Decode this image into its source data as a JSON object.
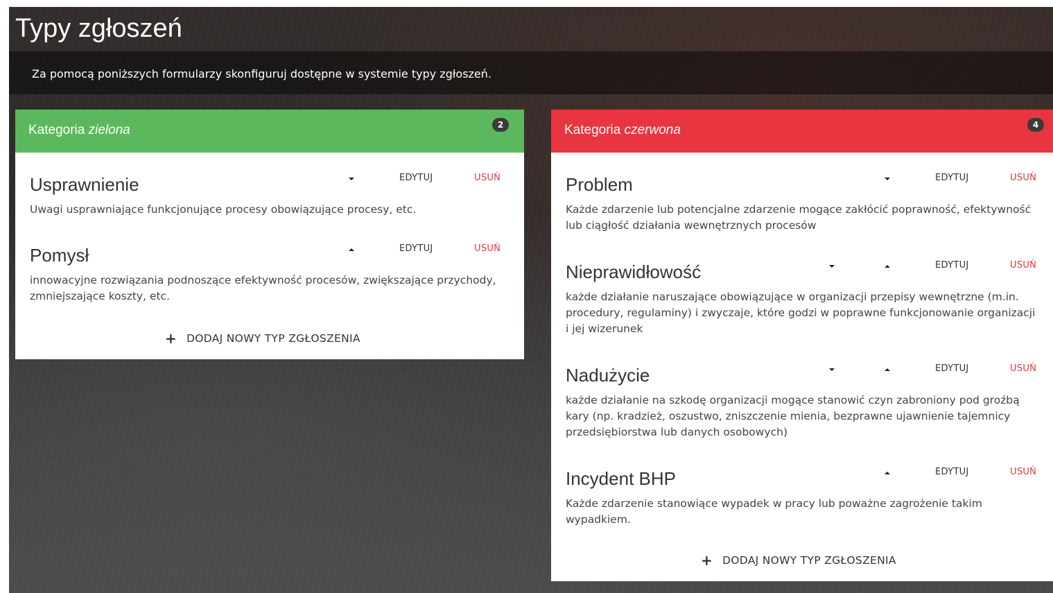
{
  "page": {
    "title": "Typy zgłoszeń",
    "description": "Za pomocą poniższych formularzy skonfiguruj dostępne w systemie typy zgłoszeń."
  },
  "colors": {
    "green": "#5cb85c",
    "red": "#e9353f",
    "badge": "#3a3a3a"
  },
  "categories": [
    {
      "label_prefix": "Kategoria",
      "label_name": "zielona",
      "count": "2",
      "add_label": "DODAJ NOWY TYP ZGŁOSZENIA",
      "items": [
        {
          "title": "Usprawnienie",
          "description": "Uwagi usprawniające funkcjonujące procesy obowiązujące procesy, etc.",
          "edit": "EDYTUJ",
          "delete": "USUŃ",
          "arrows": [
            "down-icon"
          ]
        },
        {
          "title": "Pomysł",
          "description": "innowacyjne rozwiązania podnoszące efektywność procesów, zwiększające przychody, zmniejszające koszty, etc.",
          "edit": "EDYTUJ",
          "delete": "USUŃ",
          "arrows": [
            "up-icon"
          ]
        }
      ]
    },
    {
      "label_prefix": "Kategoria",
      "label_name": "czerwona",
      "count": "4",
      "add_label": "DODAJ NOWY TYP ZGŁOSZENIA",
      "items": [
        {
          "title": "Problem",
          "description": "Każde zdarzenie lub potencjalne zdarzenie mogące zakłócić poprawność, efektywność lub ciągłość działania wewnętrznych procesów",
          "edit": "EDYTUJ",
          "delete": "USUŃ",
          "arrows": [
            "down-icon"
          ]
        },
        {
          "title": "Nieprawidłowość",
          "description": "każde działanie naruszające obowiązujące w organizacji przepisy wewnętrzne (m.in. procedury, regulaminy) i zwyczaje, które godzi w poprawne funkcjonowanie organizacji i jej wizerunek",
          "edit": "EDYTUJ",
          "delete": "USUŃ",
          "arrows": [
            "down-icon",
            "up-icon"
          ]
        },
        {
          "title": "Nadużycie",
          "description": "każde działanie na szkodę organizacji mogące stanowić czyn zabroniony pod groźbą kary (np. kradzież, oszustwo, zniszczenie mienia, bezprawne ujawnienie tajemnicy przedsiębiorstwa lub danych osobowych)",
          "edit": "EDYTUJ",
          "delete": "USUŃ",
          "arrows": [
            "down-icon",
            "up-icon"
          ]
        },
        {
          "title": "Incydent BHP",
          "description": "Każde zdarzenie stanowiące wypadek w pracy lub poważne zagrożenie takim wypadkiem.",
          "edit": "EDYTUJ",
          "delete": "USUŃ",
          "arrows": [
            "up-icon"
          ]
        }
      ]
    }
  ]
}
